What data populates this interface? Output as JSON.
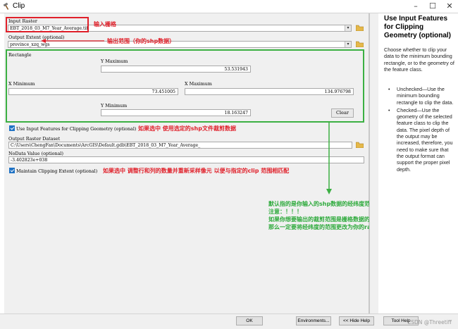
{
  "window": {
    "title": "Clip"
  },
  "form": {
    "input_raster": {
      "label": "Input Raster",
      "value": "EBT_2018_03_M7_Year_Average.tif",
      "annotation": "输入栅格"
    },
    "output_extent": {
      "label": "Output Extent (optional)",
      "value": "province_xzq_wgs",
      "annotation": "输出范围（你的shp数据）"
    },
    "rectangle": {
      "label": "Rectangle",
      "y_max_label": "Y Maximum",
      "y_max": "53.531943",
      "x_min_label": "X Minimum",
      "x_min": "73.451005",
      "x_max_label": "X Maximum",
      "x_max": "134.976798",
      "y_min_label": "Y Minimum",
      "y_min": "18.163247",
      "clear_label": "Clear"
    },
    "use_input_features": {
      "label": "Use Input Features for Clipping Geometry (optional)",
      "checked": true,
      "annotation": "如果选中 使用选定的shp文件裁剪数据"
    },
    "output_dataset": {
      "label": "Output Raster Dataset",
      "value": "C:\\Users\\ChengFan\\Documents\\ArcGIS\\Default.gdb\\EBT_2018_03_M7_Year_Average_"
    },
    "nodata": {
      "label": "NoData Value (optional)",
      "value": "-3.402823e+038"
    },
    "maintain_extent": {
      "label": "Maintain Clipping Extent (optional)",
      "checked": true,
      "annotation": "如果选中 调整行和列的数量并重新采样像元 以便与指定的clip 范围相匹配"
    },
    "green_note": [
      "默认指的是你输入的shp数据的经纬度范围",
      "注意：！！！",
      "如果你想要输出的裁剪范围是栅格数据的经纬度，",
      "那么一定要将经纬度的范围更改为你的raster的经纬度范围"
    ]
  },
  "help": {
    "title": "Use Input Features for Clipping Geometry (optional)",
    "description": "Choose whether to clip your data to the minimum bounding rectangle, or to the geometry of the feature class.",
    "items": [
      "Unchecked—Use the minimum bounding rectangle to clip the data.",
      "Checked—Use the geometry of the selected feature class to clip the data. The pixel depth of the output may be increased, therefore, you need to make sure that the output format can support the proper pixel depth."
    ]
  },
  "footer": {
    "ok": "OK",
    "environments": "Environments...",
    "hide_help": "<< Hide Help",
    "tool_help": "Tool Help"
  },
  "watermark": "CSDN @Threetiff",
  "colors": {
    "red_annotation": "#e0202a",
    "green_annotation": "#3cb043",
    "checkbox": "#1f72c4"
  }
}
